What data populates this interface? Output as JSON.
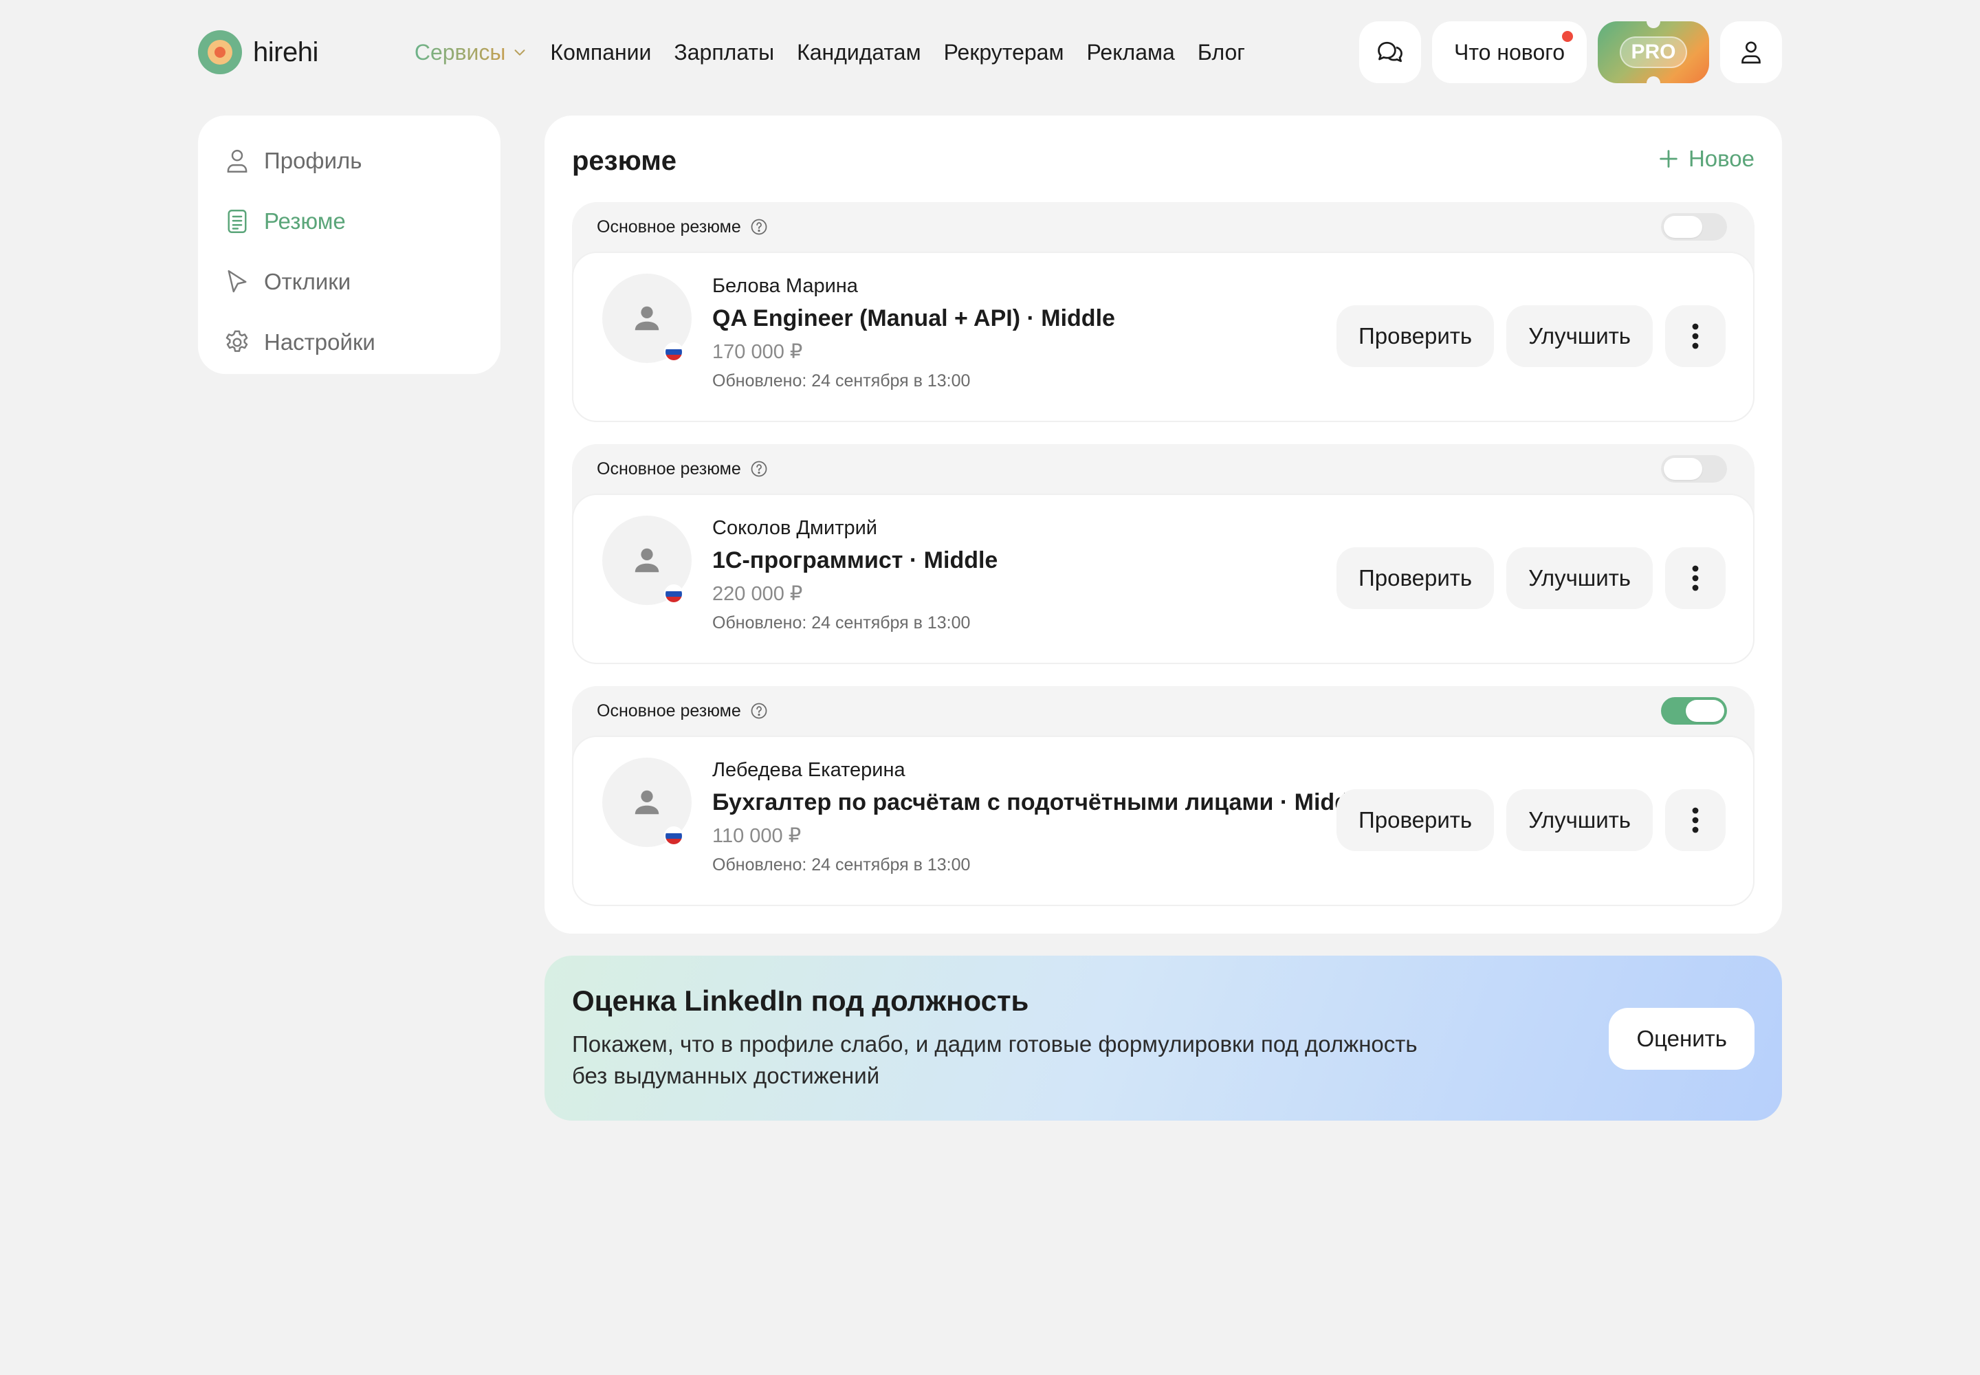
{
  "brand": {
    "name": "hirehi"
  },
  "nav": {
    "services": "Сервисы",
    "items": [
      "Компании",
      "Зарплаты",
      "Кандидатам",
      "Рекрутерам",
      "Реклама",
      "Блог"
    ]
  },
  "header": {
    "whats_new": "Что нового",
    "pro": "PRO"
  },
  "sidebar": {
    "items": [
      {
        "label": "Профиль",
        "icon": "user-icon",
        "active": false
      },
      {
        "label": "Резюме",
        "icon": "document-icon",
        "active": true
      },
      {
        "label": "Отклики",
        "icon": "cursor-icon",
        "active": false
      },
      {
        "label": "Настройки",
        "icon": "gear-icon",
        "active": false
      }
    ]
  },
  "main": {
    "title": "резюме",
    "new_label": "Новое",
    "resumes": [
      {
        "primary_label": "Основное резюме",
        "primary": false,
        "name": "Белова Марина",
        "title": "QA Engineer (Manual + API) · Middle",
        "salary": "170 000 ₽",
        "updated": "Обновлено: 24 сентября в 13:00",
        "check": "Проверить",
        "improve": "Улучшить"
      },
      {
        "primary_label": "Основное резюме",
        "primary": false,
        "name": "Соколов Дмитрий",
        "title": "1С-программист · Middle",
        "salary": "220 000 ₽",
        "updated": "Обновлено: 24 сентября в 13:00",
        "check": "Проверить",
        "improve": "Улучшить"
      },
      {
        "primary_label": "Основное резюме",
        "primary": true,
        "name": "Лебедева Екатерина",
        "title": "Бухгалтер по расчётам с подотчётными лицами · Middle",
        "salary": "110 000 ₽",
        "updated": "Обновлено: 24 сентября в 13:00",
        "check": "Проверить",
        "improve": "Улучшить"
      }
    ]
  },
  "promo": {
    "title": "Оценка LinkedIn под должность",
    "text": "Покажем, что в профиле слабо, и дадим готовые формулировки под должность без выдуманных достижений",
    "button": "Оценить"
  },
  "colors": {
    "accent": "#5aa579",
    "toggle_on": "#5fb07f",
    "background": "#f2f2f2",
    "notification": "#ef4a3c"
  }
}
